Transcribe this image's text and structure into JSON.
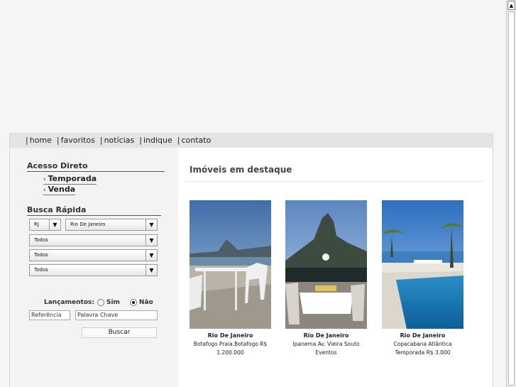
{
  "nav": {
    "items": [
      "home",
      "favoritos",
      "notícias",
      "indique",
      "contato"
    ]
  },
  "sidebar": {
    "acesso_direto": {
      "title": "Acesso Direto",
      "links": [
        "Temporada",
        "Venda"
      ]
    },
    "busca_rapida": {
      "title": "Busca Rápida",
      "state_value": "RJ",
      "city_value": "Rio De Janeiro",
      "filter1_value": "Todos",
      "filter2_value": "Todos",
      "filter3_value": "Todos",
      "lancamentos_label": "Lançamentos:",
      "option_sim": "Sim",
      "option_nao": "Não",
      "selected_option": "Não",
      "referencia_value": "Referência",
      "palavra_chave_value": "Palavra Chave",
      "search_button": "Buscar"
    }
  },
  "main": {
    "title": "Imóveis em destaque",
    "listings": [
      {
        "city": "Rio De Janeiro",
        "desc": "Botafogo Praia.Botafogo R$ 1.200.000"
      },
      {
        "city": "Rio De Janeiro",
        "desc": "Ipanema Av. Vieira Souto Eventos"
      },
      {
        "city": "Rio De Janeiro",
        "desc": "Copacabana Atlântica Temporada R$ 3.000"
      }
    ]
  },
  "icons": {
    "select_arrow": "triangle-down-icon",
    "scroll_up": "triangle-up-icon",
    "link_bullet": "chevron-right-icon"
  }
}
